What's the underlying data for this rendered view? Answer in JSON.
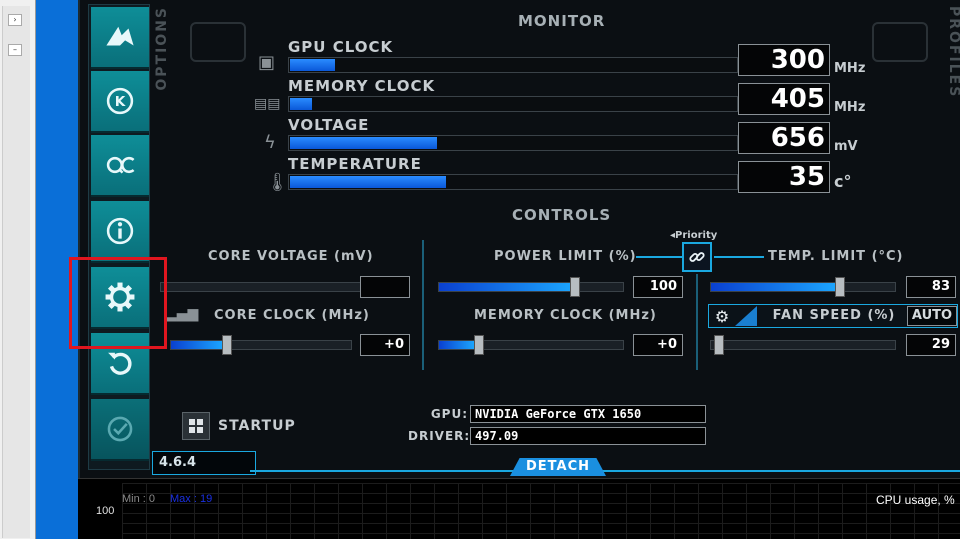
{
  "sections": {
    "monitor": "MONITOR",
    "controls": "CONTROLS",
    "options": "OPTIONS",
    "profiles": "PROFILES"
  },
  "monitor": [
    {
      "label": "GPU CLOCK",
      "value": "300",
      "unit": "MHz",
      "level": 0.1,
      "icon": "chip-icon"
    },
    {
      "label": "MEMORY CLOCK",
      "value": "405",
      "unit": "MHz",
      "level": 0.05,
      "icon": "memory-icon"
    },
    {
      "label": "VOLTAGE",
      "value": "656",
      "unit": "mV",
      "level": 0.33,
      "icon": "lightning-icon"
    },
    {
      "label": "TEMPERATURE",
      "value": "35",
      "unit": "c°",
      "level": 0.35,
      "icon": "thermometer-icon"
    }
  ],
  "controls": {
    "core_voltage": {
      "label": "CORE VOLTAGE (mV)",
      "value": ""
    },
    "core_clock": {
      "label": "CORE CLOCK (MHz)",
      "value": "+0",
      "level": 0.3
    },
    "power_limit": {
      "label": "POWER LIMIT (%)",
      "value": "100",
      "level": 0.75
    },
    "memory_clock": {
      "label": "MEMORY CLOCK (MHz)",
      "value": "+0",
      "level": 0.2
    },
    "priority": "Priority",
    "temp_limit": {
      "label": "TEMP. LIMIT (°C)",
      "value": "83",
      "level": 0.71
    },
    "fan_speed": {
      "label": "FAN SPEED (%)",
      "auto": "AUTO",
      "value": "29",
      "level": 0.02
    }
  },
  "startup": "STARTUP",
  "gpu_info": {
    "gpu_label": "GPU:",
    "gpu_value": "NVIDIA GeForce GTX 1650",
    "driver_label": "DRIVER:",
    "driver_value": "497.09"
  },
  "version": "4.6.4",
  "detach": "DETACH",
  "graph": {
    "min_label": "Min : 0",
    "max_label": "Max : 19",
    "y_label": "100",
    "title": "CPU usage, %"
  },
  "colors": {
    "accent": "#1aa8e0",
    "sidebar": "#0e8e98",
    "highlight": "#e0161f"
  }
}
